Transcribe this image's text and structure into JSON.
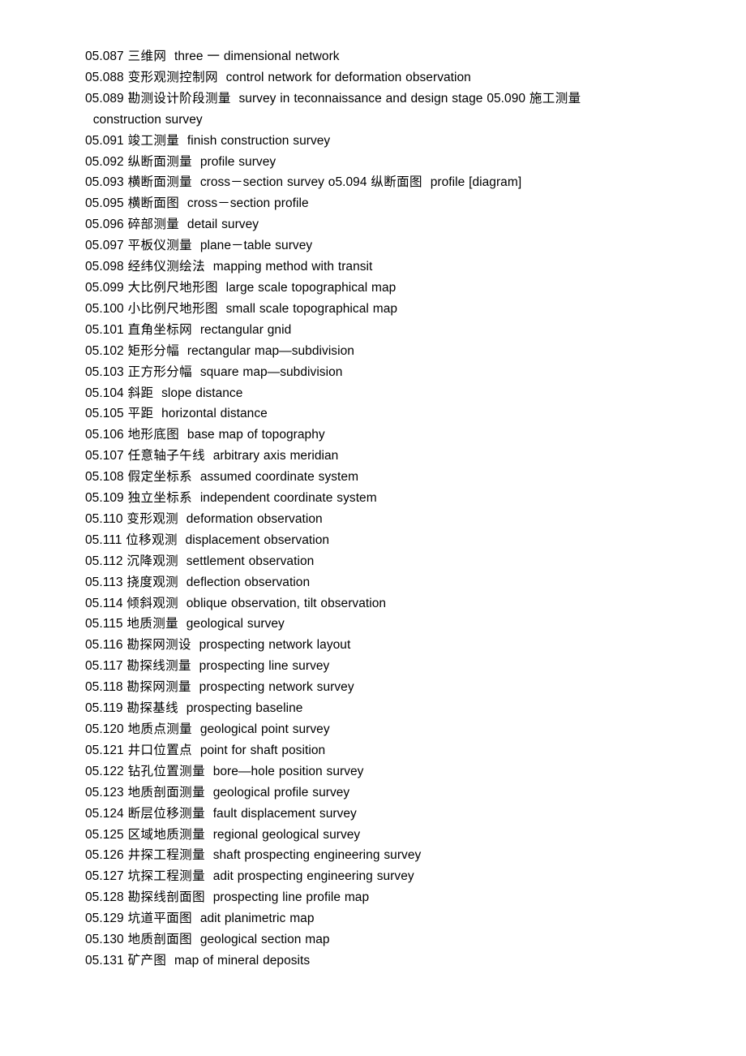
{
  "document": {
    "type": "bilingual-terminology-glossary",
    "subject": "Surveying and geological survey terms",
    "section_prefix": "05",
    "entry_range": "05.087 - 05.131",
    "text_color": "#000000",
    "background_color": "#ffffff"
  },
  "entries": [
    {
      "number": "05.087",
      "chinese": "三维网",
      "english": "three 一  dimensional network",
      "wrap_after": true
    },
    {
      "number": "05.088",
      "chinese": "变形观测控制网",
      "english": "control network for deformation observation",
      "wrap_after": true
    },
    {
      "number": "05.089",
      "chinese": "勘测设计阶段测量",
      "english": "survey in teconnaissance and design stage",
      "wrap_after": false
    },
    {
      "number": "05.090",
      "chinese": "施工测量",
      "english": "construction survey",
      "wrap_after": true
    },
    {
      "number": "05.091",
      "chinese": "竣工测量",
      "english": "finish construction survey",
      "wrap_after": true
    },
    {
      "number": "05.092",
      "chinese": "纵断面测量",
      "english": "profile survey",
      "wrap_after": true
    },
    {
      "number": "05.093",
      "chinese": "横断面测量",
      "english": "cross－section survey",
      "wrap_after": false
    },
    {
      "number": "o5.094",
      "chinese": "纵断面图",
      "english": "profile [diagram]",
      "wrap_after": true
    },
    {
      "number": "05.095",
      "chinese": "横断面图",
      "english": "cross－section profile",
      "wrap_after": true
    },
    {
      "number": "05.096",
      "chinese": "碎部测量",
      "english": "detail survey",
      "wrap_after": true
    },
    {
      "number": "05.097",
      "chinese": "平板仪测量",
      "english": "plane－table survey",
      "wrap_after": true
    },
    {
      "number": "05.098",
      "chinese": "经纬仪测绘法",
      "english": "mapping method with transit",
      "wrap_after": true
    },
    {
      "number": "05.099",
      "chinese": "大比例尺地形图",
      "english": "large scale topographical map",
      "wrap_after": true
    },
    {
      "number": "05.100",
      "chinese": "小比例尺地形图",
      "english": "small scale topographical map",
      "wrap_after": true
    },
    {
      "number": "05.101",
      "chinese": "直角坐标网",
      "english": "rectangular gnid",
      "wrap_after": true
    },
    {
      "number": "05.102",
      "chinese": "矩形分幅",
      "english": "rectangular map—subdivision",
      "wrap_after": true
    },
    {
      "number": "05.103",
      "chinese": "正方形分幅",
      "english": "square map—subdivision",
      "wrap_after": true
    },
    {
      "number": "05.104",
      "chinese": "斜距",
      "english": "slope distance",
      "wrap_after": true
    },
    {
      "number": "05.105",
      "chinese": "平距",
      "english": "horizontal distance",
      "wrap_after": true
    },
    {
      "number": "05.106",
      "chinese": "地形底图",
      "english": "base map of topography",
      "wrap_after": true
    },
    {
      "number": "05.107",
      "chinese": "任意轴子午线",
      "english": "arbitrary axis meridian",
      "wrap_after": true
    },
    {
      "number": "05.108",
      "chinese": "假定坐标系",
      "english": "assumed coordinate system",
      "wrap_after": true
    },
    {
      "number": "05.109",
      "chinese": "独立坐标系",
      "english": "independent coordinate system",
      "wrap_after": true
    },
    {
      "number": "05.110",
      "chinese": "变形观测",
      "english": "deformation observation",
      "wrap_after": true
    },
    {
      "number": "05.111",
      "chinese": "位移观测",
      "english": "displacement observation",
      "wrap_after": true
    },
    {
      "number": "05.112",
      "chinese": "沉降观测",
      "english": "settlement observation",
      "wrap_after": true
    },
    {
      "number": "05.113",
      "chinese": "挠度观测",
      "english": "deflection observation",
      "wrap_after": true
    },
    {
      "number": "05.114",
      "chinese": "倾斜观测",
      "english": "oblique observation, tilt observation",
      "wrap_after": true
    },
    {
      "number": "05.115",
      "chinese": "地质测量",
      "english": "geological survey",
      "wrap_after": true
    },
    {
      "number": "05.116",
      "chinese": "勘探网测设",
      "english": "prospecting network layout",
      "wrap_after": true
    },
    {
      "number": "05.117",
      "chinese": "勘探线测量",
      "english": "prospecting line survey",
      "wrap_after": true
    },
    {
      "number": "05.118",
      "chinese": "勘探网测量",
      "english": "prospecting network survey",
      "wrap_after": true
    },
    {
      "number": "05.119",
      "chinese": "勘探基线",
      "english": "prospecting baseline",
      "wrap_after": true
    },
    {
      "number": "05.120",
      "chinese": "地质点测量",
      "english": "geological point survey",
      "wrap_after": true
    },
    {
      "number": "05.121",
      "chinese": "井口位置点",
      "english": "point for shaft position",
      "wrap_after": true
    },
    {
      "number": "05.122",
      "chinese": "钻孔位置测量",
      "english": "bore—hole position survey",
      "wrap_after": true
    },
    {
      "number": "05.123",
      "chinese": "地质剖面测量",
      "english": "geological profile survey",
      "wrap_after": true
    },
    {
      "number": "05.124",
      "chinese": "断层位移测量",
      "english": "fault displacement survey",
      "wrap_after": true
    },
    {
      "number": "05.125",
      "chinese": "区域地质测量",
      "english": "regional geological survey",
      "wrap_after": true
    },
    {
      "number": "05.126",
      "chinese": "井探工程测量",
      "english": "shaft prospecting engineering survey",
      "wrap_after": true
    },
    {
      "number": "05.127",
      "chinese": "坑探工程测量",
      "english": "adit prospecting engineering survey",
      "wrap_after": true
    },
    {
      "number": "05.128",
      "chinese": "勘探线剖面图",
      "english": "prospecting line profile map",
      "wrap_after": true
    },
    {
      "number": "05.129",
      "chinese": "坑道平面图",
      "english": "adit planimetric map",
      "wrap_after": true
    },
    {
      "number": "05.130",
      "chinese": "地质剖面图",
      "english": "geological section map",
      "wrap_after": true
    },
    {
      "number": "05.131",
      "chinese": "矿产图",
      "english": "map of mineral deposits",
      "wrap_after": true
    }
  ]
}
